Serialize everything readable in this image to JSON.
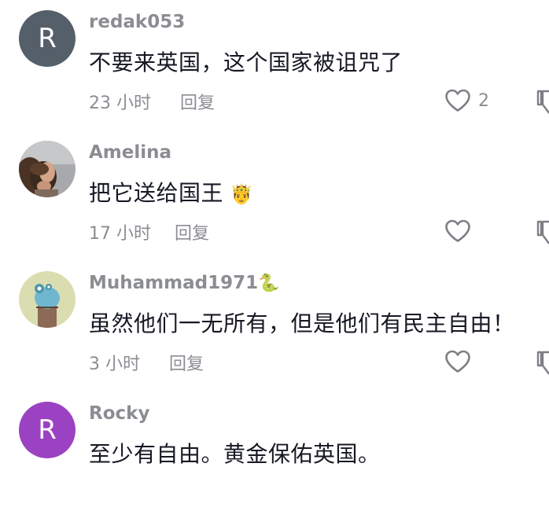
{
  "icons": {
    "like": "heart-outline-icon",
    "dislike": "thumbs-down-outline-icon"
  },
  "comments": [
    {
      "avatar": {
        "type": "letter",
        "letter": "R",
        "color": "#555f69"
      },
      "username": "redak053",
      "text": "不要来英国，这个国家被诅咒了",
      "time": "23 小时",
      "reply_label": "回复",
      "like_count": "2"
    },
    {
      "avatar": {
        "type": "photo"
      },
      "username": "Amelina",
      "text": "把它送给国王",
      "text_emoji": "🤴",
      "time": "17 小时",
      "reply_label": "回复",
      "like_count": ""
    },
    {
      "avatar": {
        "type": "illustration"
      },
      "username": "Muhammad1971",
      "username_emoji": "🐍",
      "text": "虽然他们一无所有，但是他们有民主自由！",
      "time": "3 小时",
      "reply_label": "回复",
      "like_count": ""
    },
    {
      "avatar": {
        "type": "letter",
        "letter": "R",
        "color": "#9b42c2"
      },
      "username": "Rocky",
      "text": "至少有自由。黄金保佑英国。",
      "time": "",
      "reply_label": "",
      "like_count": ""
    }
  ]
}
